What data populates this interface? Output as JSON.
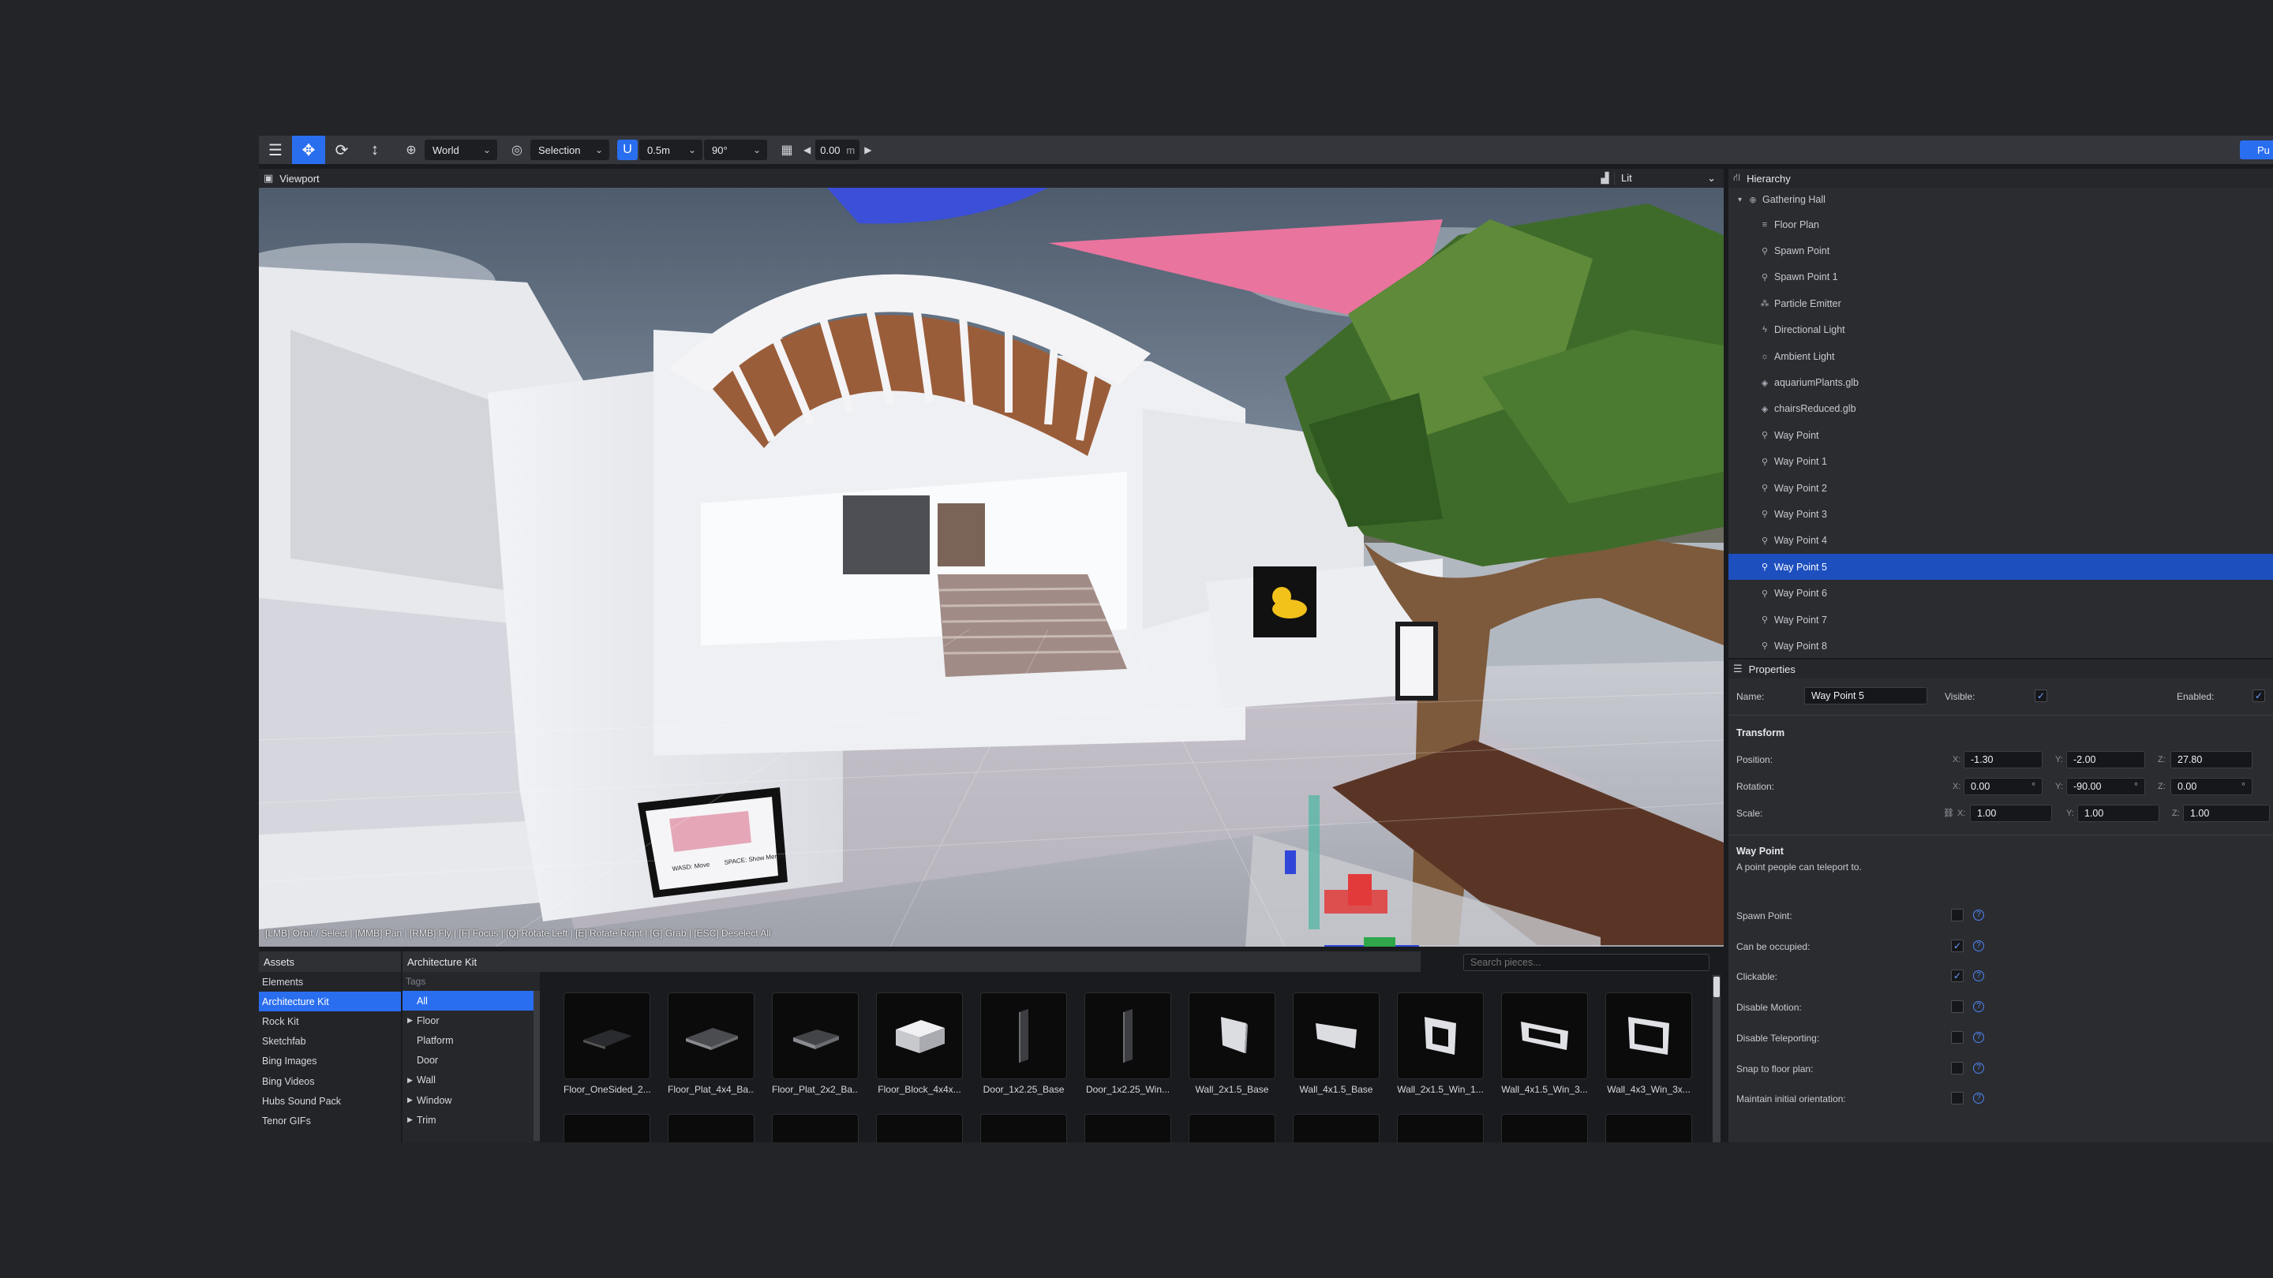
{
  "toolbar": {
    "coordinate_space": "World",
    "selection_mode": "Selection",
    "snap_translate": "0.5m",
    "snap_rotate": "90°",
    "grid_height": "0.00",
    "grid_unit": "m",
    "publish_label": "Pu"
  },
  "viewport": {
    "title": "Viewport",
    "render_mode": "Lit",
    "hint": "[LMB] Orbit / Select | [MMB] Pan | [RMB] Fly | [F] Focus | [Q] Rotate Left | [E] Rotate Right | [G] Grab | [ESC] Deselect All",
    "sign_left_text": "WASD: Move\nE Key: Fly Mode",
    "sign_right_text": "SPACE: Show Menus\nTAB: Toggle Menus"
  },
  "hierarchy": {
    "title": "Hierarchy",
    "root": "Gathering Hall",
    "items": [
      {
        "label": "Floor Plan",
        "icon": "floor-plan-icon",
        "glyph": "≡"
      },
      {
        "label": "Spawn Point",
        "icon": "spawn-point-icon",
        "glyph": "⚲"
      },
      {
        "label": "Spawn Point 1",
        "icon": "spawn-point-icon",
        "glyph": "⚲"
      },
      {
        "label": "Particle Emitter",
        "icon": "particle-emitter-icon",
        "glyph": "⁂"
      },
      {
        "label": "Directional Light",
        "icon": "directional-light-icon",
        "glyph": "ϟ"
      },
      {
        "label": "Ambient Light",
        "icon": "ambient-light-icon",
        "glyph": "☼"
      },
      {
        "label": "aquariumPlants.glb",
        "icon": "model-icon",
        "glyph": "◈"
      },
      {
        "label": "chairsReduced.glb",
        "icon": "model-icon",
        "glyph": "◈"
      },
      {
        "label": "Way Point",
        "icon": "waypoint-icon",
        "glyph": "⚲"
      },
      {
        "label": "Way Point 1",
        "icon": "waypoint-icon",
        "glyph": "⚲"
      },
      {
        "label": "Way Point 2",
        "icon": "waypoint-icon",
        "glyph": "⚲"
      },
      {
        "label": "Way Point 3",
        "icon": "waypoint-icon",
        "glyph": "⚲"
      },
      {
        "label": "Way Point 4",
        "icon": "waypoint-icon",
        "glyph": "⚲"
      },
      {
        "label": "Way Point 5",
        "icon": "waypoint-icon",
        "glyph": "⚲",
        "selected": true
      },
      {
        "label": "Way Point 6",
        "icon": "waypoint-icon",
        "glyph": "⚲"
      },
      {
        "label": "Way Point 7",
        "icon": "waypoint-icon",
        "glyph": "⚲"
      },
      {
        "label": "Way Point 8",
        "icon": "waypoint-icon",
        "glyph": "⚲"
      }
    ]
  },
  "properties": {
    "title": "Properties",
    "name_label": "Name:",
    "name_value": "Way Point 5",
    "visible_label": "Visible:",
    "visible": true,
    "enabled_label": "Enabled:",
    "enabled": true,
    "transform_title": "Transform",
    "position_label": "Position:",
    "rotation_label": "Rotation:",
    "scale_label": "Scale:",
    "axis_x": "X:",
    "axis_y": "Y:",
    "axis_z": "Z:",
    "position": {
      "x": "-1.30",
      "y": "-2.00",
      "z": "27.80"
    },
    "rotation": {
      "x": "0.00",
      "y": "-90.00",
      "z": "0.00",
      "unit": "°"
    },
    "scale": {
      "x": "1.00",
      "y": "1.00",
      "z": "1.00"
    },
    "waypoint_title": "Way Point",
    "waypoint_desc": "A point people can teleport to.",
    "flags": [
      {
        "label": "Spawn Point:",
        "checked": false
      },
      {
        "label": "Can be occupied:",
        "checked": true
      },
      {
        "label": "Clickable:",
        "checked": true
      },
      {
        "label": "Disable Motion:",
        "checked": false
      },
      {
        "label": "Disable Teleporting:",
        "checked": false
      },
      {
        "label": "Snap to floor plan:",
        "checked": false
      },
      {
        "label": "Maintain initial orientation:",
        "checked": false
      }
    ]
  },
  "assets": {
    "sources_title": "Assets",
    "sources": [
      {
        "label": "Elements"
      },
      {
        "label": "Architecture Kit",
        "selected": true
      },
      {
        "label": "Rock Kit"
      },
      {
        "label": "Sketchfab"
      },
      {
        "label": "Bing Images"
      },
      {
        "label": "Bing Videos"
      },
      {
        "label": "Hubs Sound Pack"
      },
      {
        "label": "Tenor GIFs"
      }
    ],
    "kit_title": "Architecture Kit",
    "tags_title": "Tags",
    "tags": [
      {
        "label": "All",
        "selected": true,
        "caret": false
      },
      {
        "label": "Floor",
        "caret": true
      },
      {
        "label": "Platform",
        "caret": false
      },
      {
        "label": "Door",
        "caret": false
      },
      {
        "label": "Wall",
        "caret": true
      },
      {
        "label": "Window",
        "caret": true
      },
      {
        "label": "Trim",
        "caret": true
      }
    ],
    "search_placeholder": "Search pieces...",
    "pieces": [
      {
        "label": "Floor_OneSided_2...",
        "shape": "flat-dark"
      },
      {
        "label": "Floor_Plat_4x4_Ba...",
        "shape": "flat-grey"
      },
      {
        "label": "Floor_Plat_2x2_Ba...",
        "shape": "flat-grey-small"
      },
      {
        "label": "Floor_Block_4x4x...",
        "shape": "block"
      },
      {
        "label": "Door_1x2.25_Base",
        "shape": "door"
      },
      {
        "label": "Door_1x2.25_Win...",
        "shape": "door"
      },
      {
        "label": "Wall_2x1.5_Base",
        "shape": "wall"
      },
      {
        "label": "Wall_4x1.5_Base",
        "shape": "wall-wide"
      },
      {
        "label": "Wall_2x1.5_Win_1...",
        "shape": "wall-window"
      },
      {
        "label": "Wall_4x1.5_Win_3...",
        "shape": "wall-window-wide"
      },
      {
        "label": "Wall_4x3_Win_3x...",
        "shape": "wall-window-big"
      }
    ]
  }
}
